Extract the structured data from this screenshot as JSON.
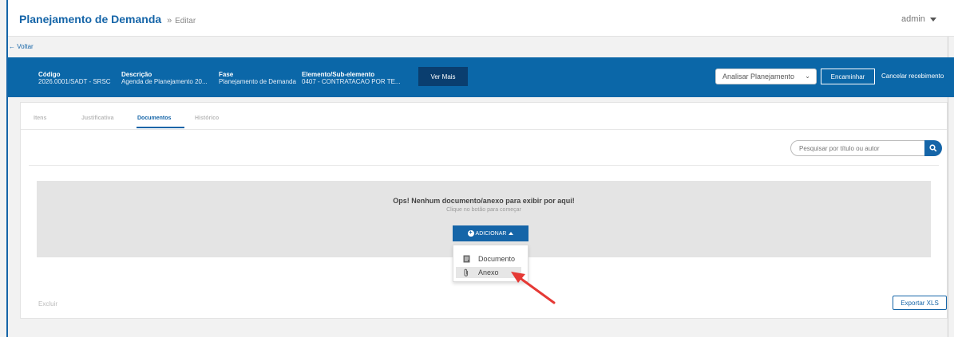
{
  "header": {
    "app_title": "Planejamento de Demanda",
    "breadcrumb_sep": "»",
    "breadcrumb": "Editar",
    "user": "admin"
  },
  "back_link": "← Voltar",
  "info": {
    "codigo_label": "Código",
    "codigo_value": "2026.0001/SADT - SRSC",
    "descricao_label": "Descrição",
    "descricao_value": "Agenda de Planejamento 20...",
    "fase_label": "Fase",
    "fase_value": "Planejamento de Demanda",
    "elemento_label": "Elemento/Sub-elemento",
    "elemento_value": "0407 - CONTRATACAO POR TE...",
    "ver_mais": "Ver Mais",
    "action_select": "Analisar Planejamento",
    "encaminhar": "Encaminhar",
    "cancelar": "Cancelar recebimento"
  },
  "tabs": [
    {
      "label": "Itens"
    },
    {
      "label": "Justificativa"
    },
    {
      "label": "Documentos"
    },
    {
      "label": "Histórico"
    }
  ],
  "active_tab": "Documentos",
  "search": {
    "placeholder": "Pesquisar por título ou autor"
  },
  "empty_state": {
    "title": "Ops! Nenhum documento/anexo para exibir por aqui!",
    "subtitle": "Clique no botão para começar",
    "add_button": "ADICIONAR"
  },
  "dropdown": {
    "items": [
      {
        "label": "Documento",
        "icon": "document-icon"
      },
      {
        "label": "Anexo",
        "icon": "paperclip-icon"
      }
    ],
    "hovered": "Anexo"
  },
  "footer": {
    "excluir": "Excluir",
    "export": "Exportar XLS"
  },
  "colors": {
    "brand": "#1565a8",
    "infobar": "#0b67a8",
    "ver_mais_bg": "#0a3e6f",
    "annotation_arrow": "#e53935"
  }
}
